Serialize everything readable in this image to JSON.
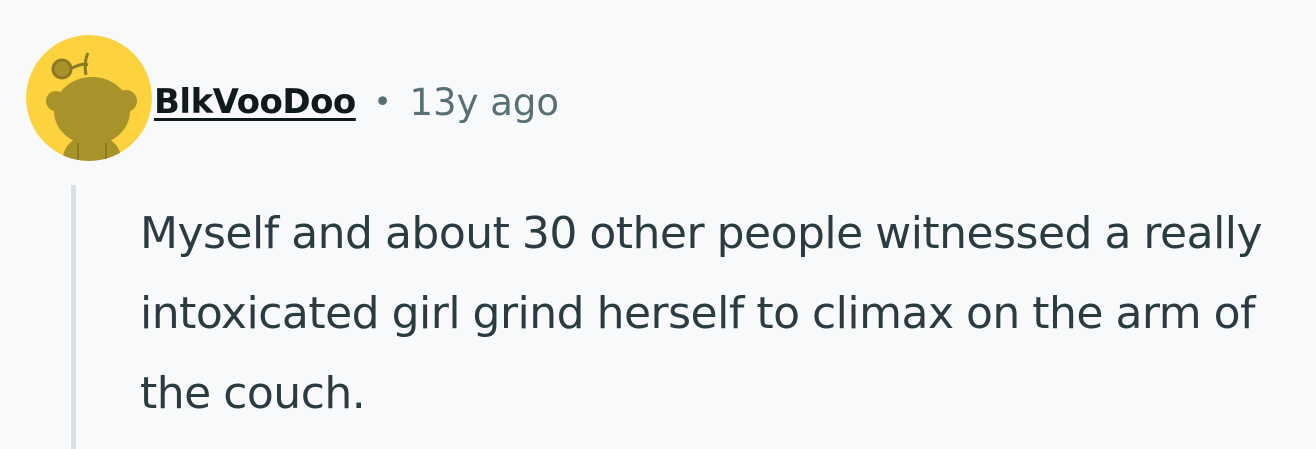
{
  "comment": {
    "avatar_icon": "reddit-snoo-icon",
    "avatar_color": "#fcd33f",
    "username": "BlkVooDoo",
    "separator": "•",
    "age": "13y ago",
    "body": "Myself and about 30 other people witnessed a really intoxicated girl grind herself to climax on the arm of the couch."
  },
  "colors": {
    "background": "#f7f9fa",
    "username": "#0f1a1c",
    "meta": "#576f76",
    "body": "#2a3c42",
    "thread_line": "#d5e2ea"
  }
}
